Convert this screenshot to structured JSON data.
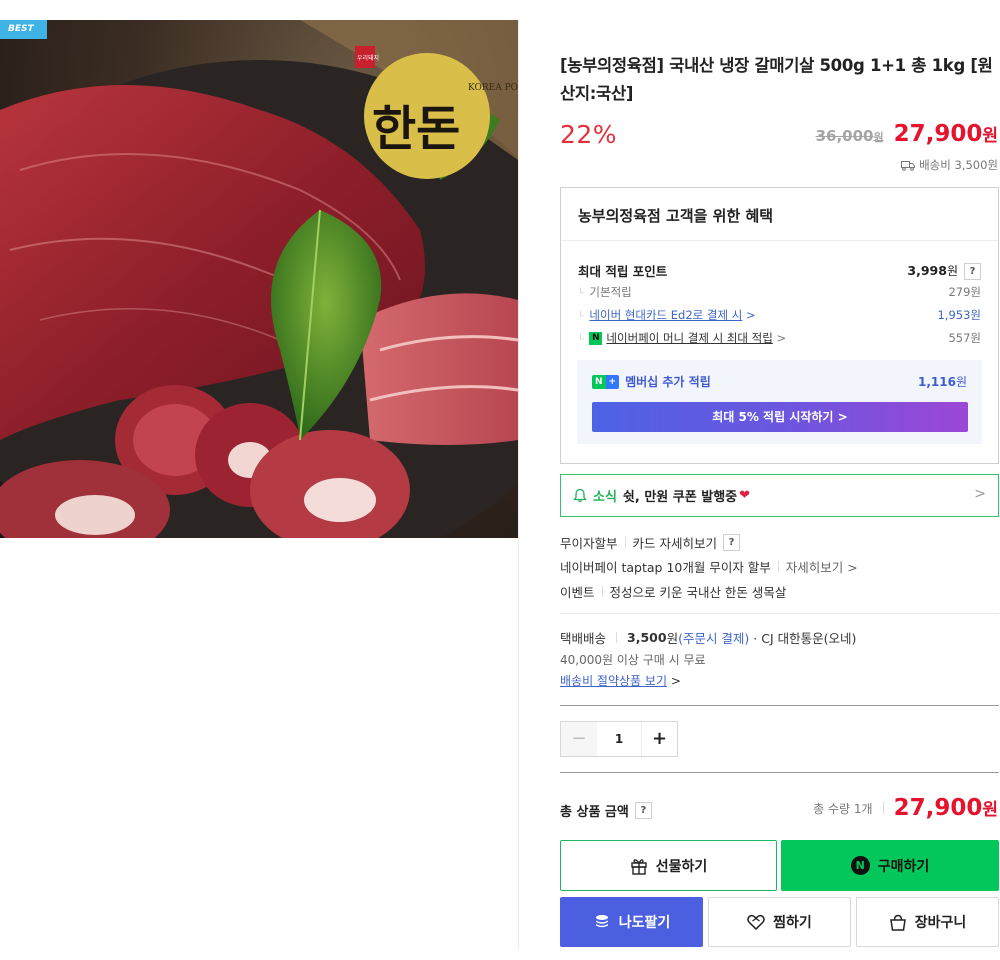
{
  "badge": {
    "best": "BEST"
  },
  "product": {
    "title": "[농부의정육점] 국내산 냉장 갈매기살 500g 1+1 총 1kg [원산지:국산]",
    "discount": "22%",
    "original_price": "36,000",
    "original_unit": "원",
    "sale_price": "27,900",
    "sale_unit": "원",
    "shipping_fee_small": "배송비 3,500원",
    "logo_text": "한돈",
    "logo_sub": "KOREA PORK",
    "logo_stamp": "우리돼지"
  },
  "benefit": {
    "title": "농부의정육점 고객을 위한 혜택",
    "max_point_label": "최대 적립 포인트",
    "max_point_value": "3,998",
    "max_point_unit": "원",
    "help": "?",
    "rows": [
      {
        "label": "기본적립",
        "value": "279원"
      },
      {
        "label": "네이버 현대카드 Ed2로 결제 시",
        "chevron": ">",
        "value": "1,953원"
      },
      {
        "label": "네이버페이 머니 결제 시 최대 적립",
        "chevron": ">",
        "value": "557원"
      }
    ],
    "membership_label": "멤버십 추가 적립",
    "membership_value": "1,116",
    "membership_unit": "원",
    "membership_button": "최대 5% 적립 시작하기",
    "badge_n": "N",
    "badge_plus": "+"
  },
  "news": {
    "head": "소식",
    "text": "쉿, 만원 쿠폰 발행중",
    "heart": "❤",
    "chevron": ">"
  },
  "installment": {
    "row1": {
      "a": "무이자할부",
      "b": "카드 자세히보기",
      "q": "?"
    },
    "row2": {
      "a": "네이버페이 taptap 10개월 무이자 할부",
      "b": "자세히보기",
      "chevron": ">"
    },
    "row3": {
      "a": "이벤트",
      "b": "정성으로 키운 국내산 한돈 생목살"
    }
  },
  "delivery": {
    "type": "택배배송",
    "fee": "3,500",
    "fee_unit": "원",
    "fee_note": "(주문시 결제)",
    "carrier": "· CJ 대한통운(오네)",
    "free_note": "40,000원 이상 구매 시 무료",
    "saving_link": "배송비 절약상품 보기",
    "chevron": ">"
  },
  "quantity": {
    "minus": "−",
    "value": "1",
    "plus": "+"
  },
  "total": {
    "label": "총 상품 금액",
    "help": "?",
    "count": "총 수량 1개",
    "amount": "27,900",
    "unit": "원"
  },
  "buttons": {
    "gift": "선물하기",
    "buy": "구매하기",
    "buy_icon": "N",
    "nado": "나도팔기",
    "zzim": "찜하기",
    "cart": "장바구니"
  },
  "colors": {
    "sale_red": "#e5142e",
    "naver_green": "#03c75a",
    "member_blue": "#4b5fe0",
    "link_blue": "#4065c9"
  }
}
